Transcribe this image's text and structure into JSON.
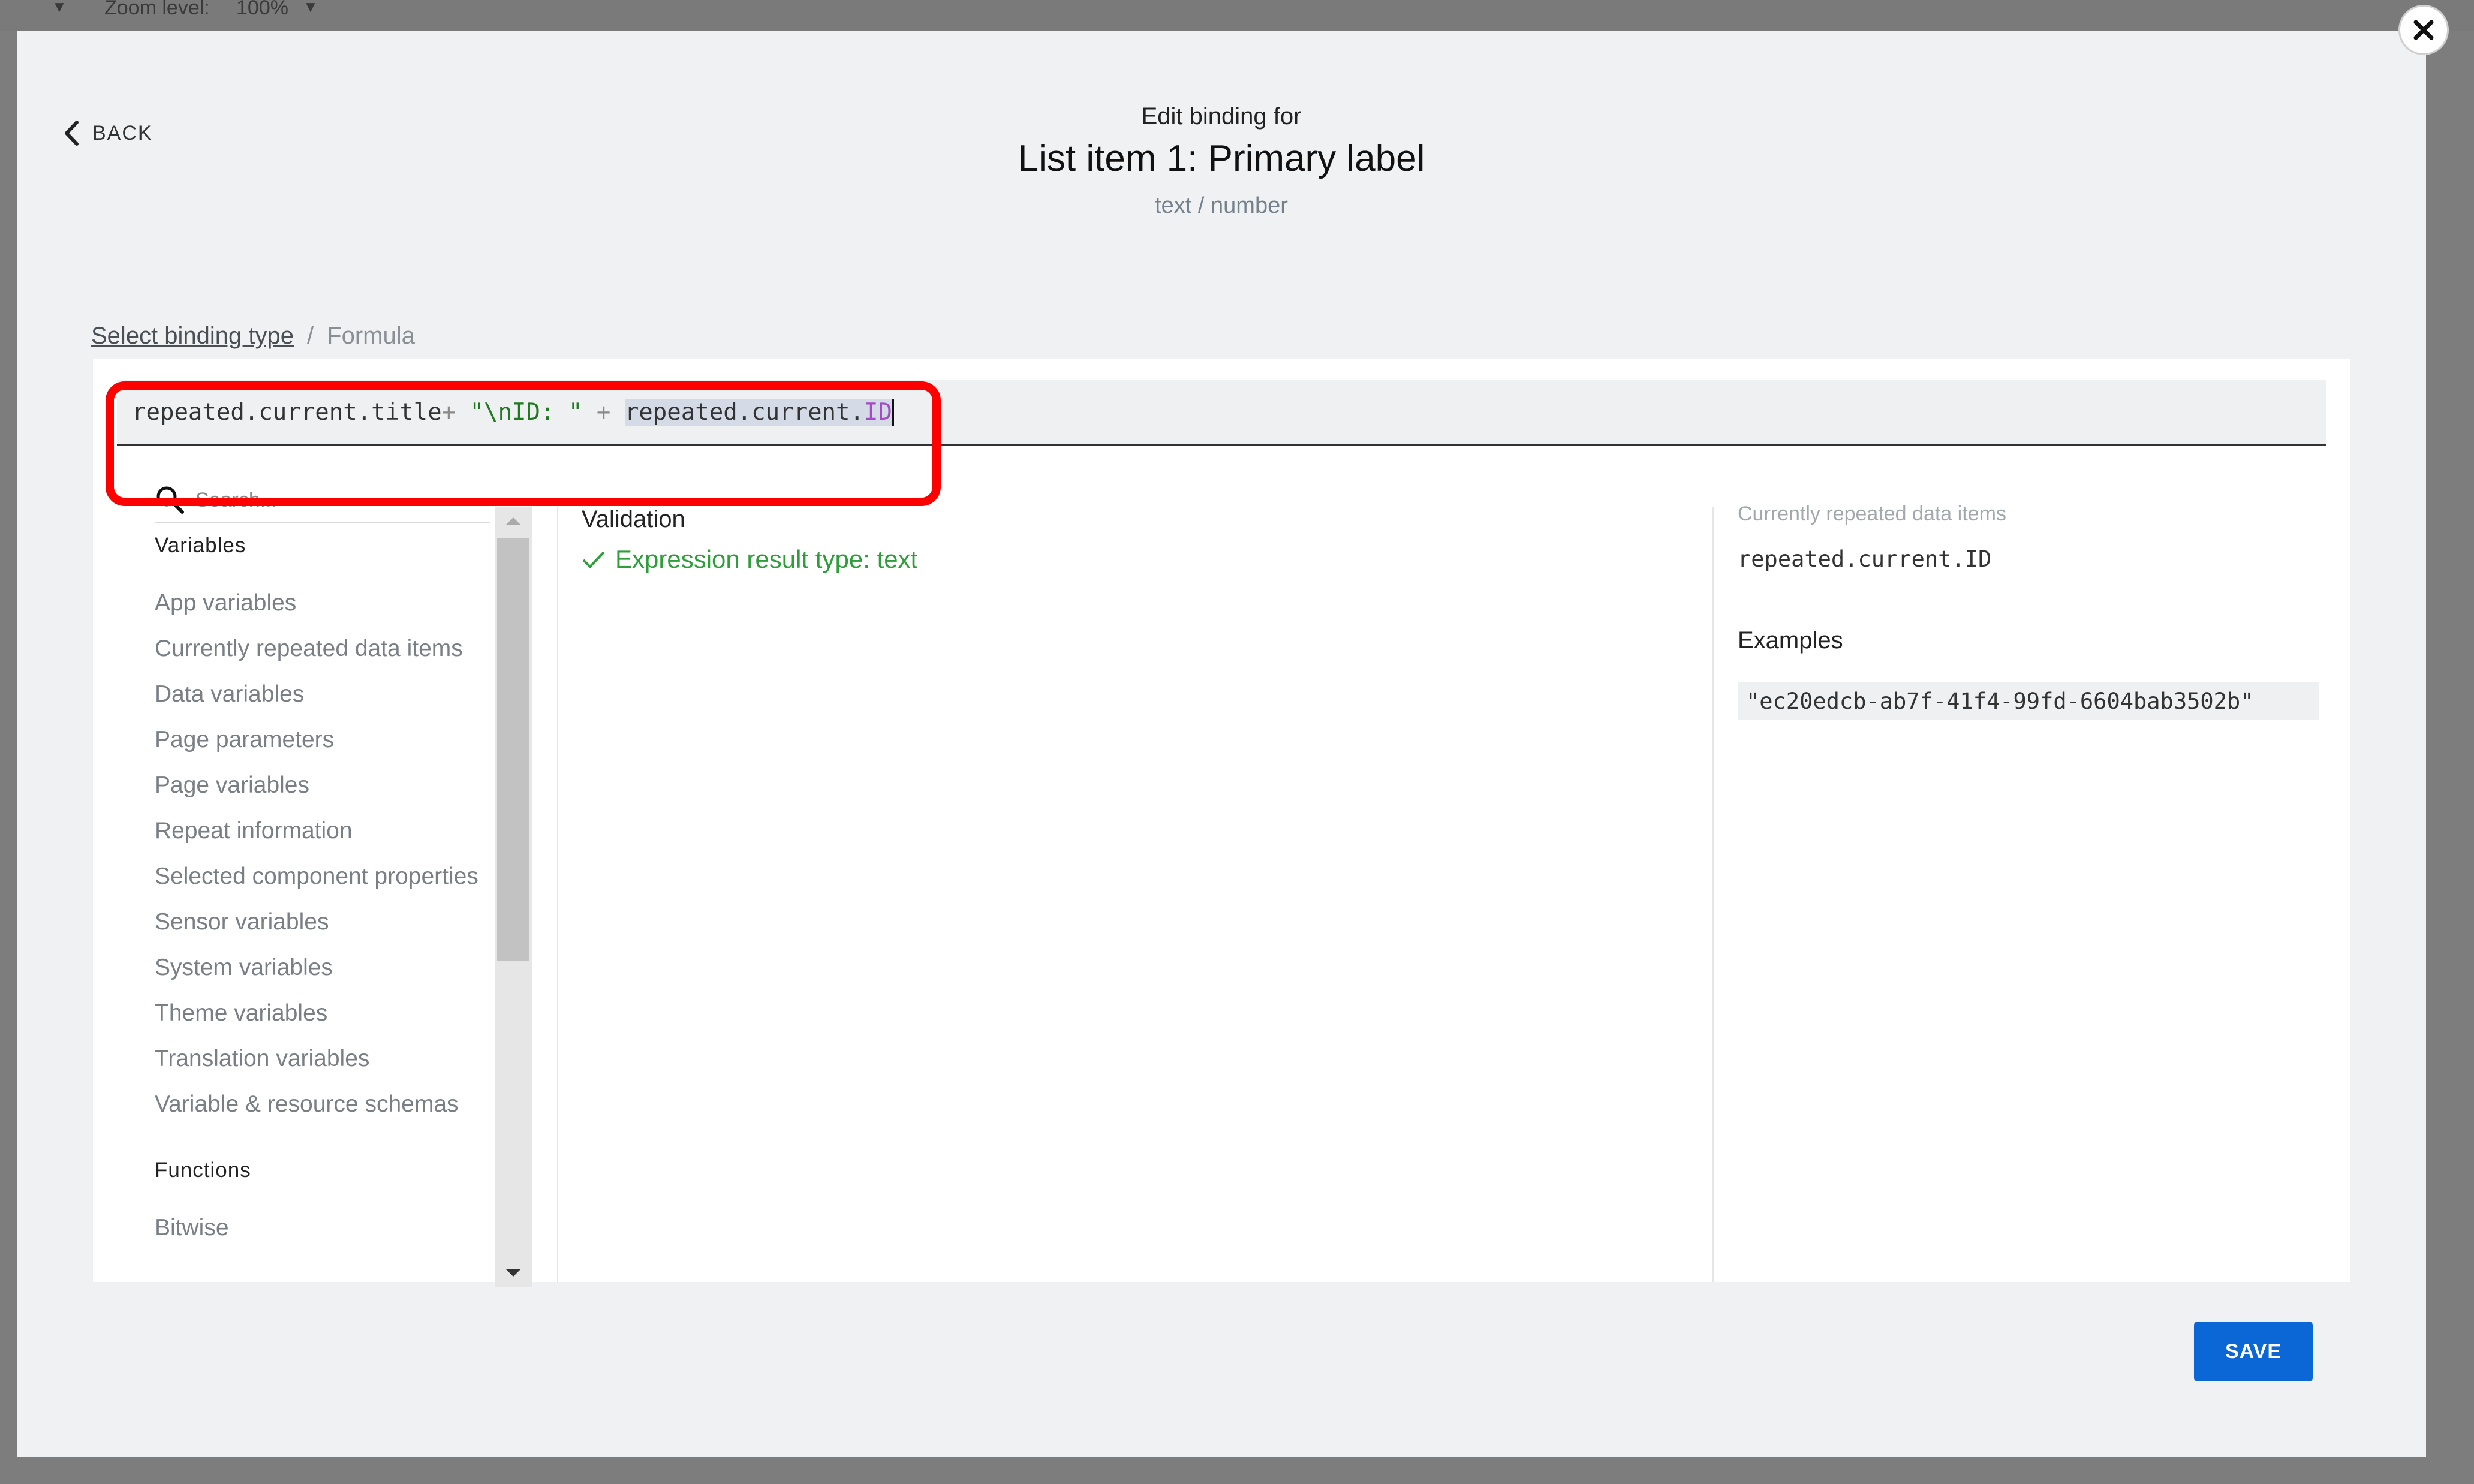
{
  "topbar": {
    "zoom_label": "Zoom level:",
    "zoom_value": "100%"
  },
  "back": {
    "label": "BACK"
  },
  "header": {
    "subtitle": "Edit binding for",
    "title": "List item 1: Primary label",
    "type": "text / number"
  },
  "breadcrumb": {
    "link": "Select binding type",
    "separator": "/",
    "current": "Formula"
  },
  "formula": {
    "part1": "repeated.current.title",
    "op1": "+ ",
    "str": "\"\\nID: \"",
    "op2": " + ",
    "hl_obj": "repeated.current.",
    "hl_prop": "ID"
  },
  "search": {
    "placeholder": "Search..."
  },
  "sidebar": {
    "variables_title": "Variables",
    "variables": [
      "App variables",
      "Currently repeated data items",
      "Data variables",
      "Page parameters",
      "Page variables",
      "Repeat information",
      "Selected component properties",
      "Sensor variables",
      "System variables",
      "Theme variables",
      "Translation variables",
      "Variable & resource schemas"
    ],
    "functions_title": "Functions",
    "functions": [
      "Bitwise"
    ]
  },
  "validation": {
    "title": "Validation",
    "result": "Expression result type: text"
  },
  "right": {
    "title": "Currently repeated data items",
    "variable": "repeated.current.ID",
    "examples_title": "Examples",
    "example": "\"ec20edcb-ab7f-41f4-99fd-6604bab3502b\""
  },
  "save": {
    "label": "SAVE"
  },
  "colors": {
    "accent": "#0b66d6",
    "success": "#2e9e3a",
    "annotation": "#ff0000"
  }
}
